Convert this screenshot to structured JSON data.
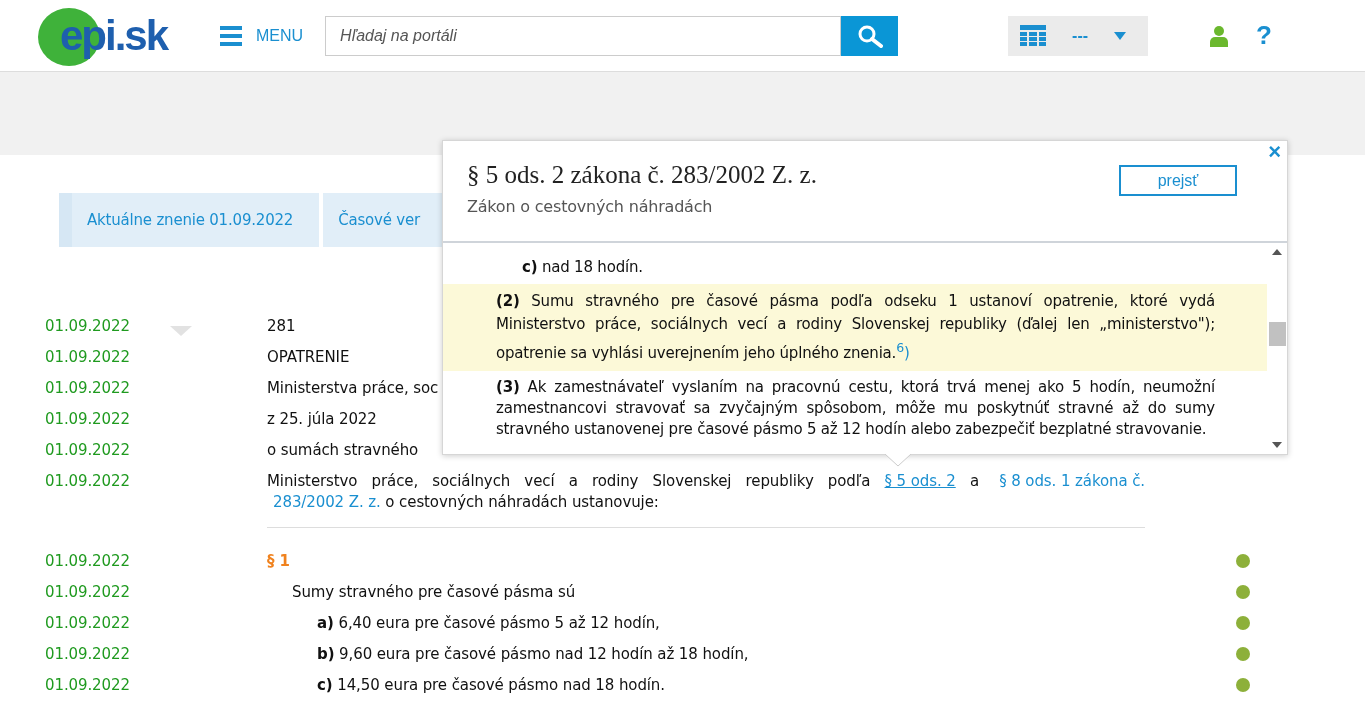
{
  "header": {
    "logo": "epi.sk",
    "menu_label": "MENU",
    "search": {
      "placeholder": "Hľadaj na portáli"
    },
    "view_select": {
      "value": "---"
    },
    "help": "?"
  },
  "tabs": [
    {
      "label": "Aktuálne znenie 01.09.2022"
    },
    {
      "label": "Časové ver"
    }
  ],
  "document_rows": [
    {
      "date": "01.09.2022",
      "kind": "plain",
      "text": "281",
      "collapse_caret": true
    },
    {
      "date": "01.09.2022",
      "kind": "plain",
      "text": "OPATRENIE"
    },
    {
      "date": "01.09.2022",
      "kind": "plain",
      "text": "Ministerstva práce, soc"
    },
    {
      "date": "01.09.2022",
      "kind": "plain",
      "text": "z 25. júla 2022"
    },
    {
      "date": "01.09.2022",
      "kind": "plain",
      "text": "o sumách stravného"
    },
    {
      "date": "01.09.2022",
      "kind": "linked",
      "segments": [
        {
          "kind": "text",
          "text": "Ministerstvo práce, sociálnych vecí a rodiny Slovenskej republiky podľa "
        },
        {
          "kind": "underlined_link",
          "text": "§ 5 ods. 2"
        },
        {
          "kind": "text",
          "text": " a "
        },
        {
          "kind": "link",
          "text": "§ 8 ods. 1 zákona č."
        },
        {
          "kind": "link",
          "text": "283/2002 Z. z."
        },
        {
          "kind": "text",
          "text": " o cestovných náhradách ustanovuje:"
        }
      ],
      "collapse_caret": false,
      "dot": false
    },
    {
      "kind": "divider"
    },
    {
      "date": "01.09.2022",
      "kind": "heading",
      "text": "§ 1",
      "collapse_caret": false,
      "dot": true
    },
    {
      "date": "01.09.2022",
      "kind": "paragraph",
      "text": "Sumy stravného pre časové pásma sú",
      "collapse_caret": false,
      "dot": true
    },
    {
      "date": "01.09.2022",
      "kind": "item",
      "text": "**a)** 6,40 eura pre časové pásmo 5 až 12 hodín,",
      "collapse_caret": false,
      "dot": true
    },
    {
      "date": "01.09.2022",
      "kind": "item",
      "text": "**b)** 9,60 eura pre časové pásmo nad 12 hodín až 18 hodín,",
      "collapse_caret": false,
      "dot": true
    },
    {
      "date": "01.09.2022",
      "kind": "item",
      "text": "**c)** 14,50 eura pre časové pásmo nad 18 hodín.",
      "collapse_caret": false,
      "dot": true
    }
  ],
  "popup": {
    "title": "§ 5 ods. 2 zákona č. 283/2002 Z. z.",
    "subtitle": "Zákon o cestovných náhradách",
    "button": "prejsť",
    "close": "×",
    "paragraphs": [
      {
        "kind": "item",
        "text": "**c)** nad 18 hodín.",
        "highlighted": false
      },
      {
        "kind": "paragraph",
        "text": "**(2)** Sumu stravného pre časové pásma podľa odseku 1 ustanoví opatrenie, ktoré vydá Ministerstvo práce, sociálnych vecí a rodiny Slovenskej republiky (ďalej len „ministerstvo\"); opatrenie sa vyhlási uverejnením jeho úplného znenia.",
        "footnote": "$^{6}$)",
        "highlighted": true
      },
      {
        "kind": "paragraph",
        "text": "**(3)** Ak zamestnávateľ vyslaním na pracovnú cestu, ktorá trvá menej ako 5 hodín, neumožní zamestnancovi stravovať sa zvyčajným spôsobom, môže mu poskytnúť stravné až do sumy stravného ustanovenej pre časové pásmo 5 až 12 hodín alebo zabezpečiť bezplatné stravovanie.",
        "highlighted": false
      }
    ]
  }
}
